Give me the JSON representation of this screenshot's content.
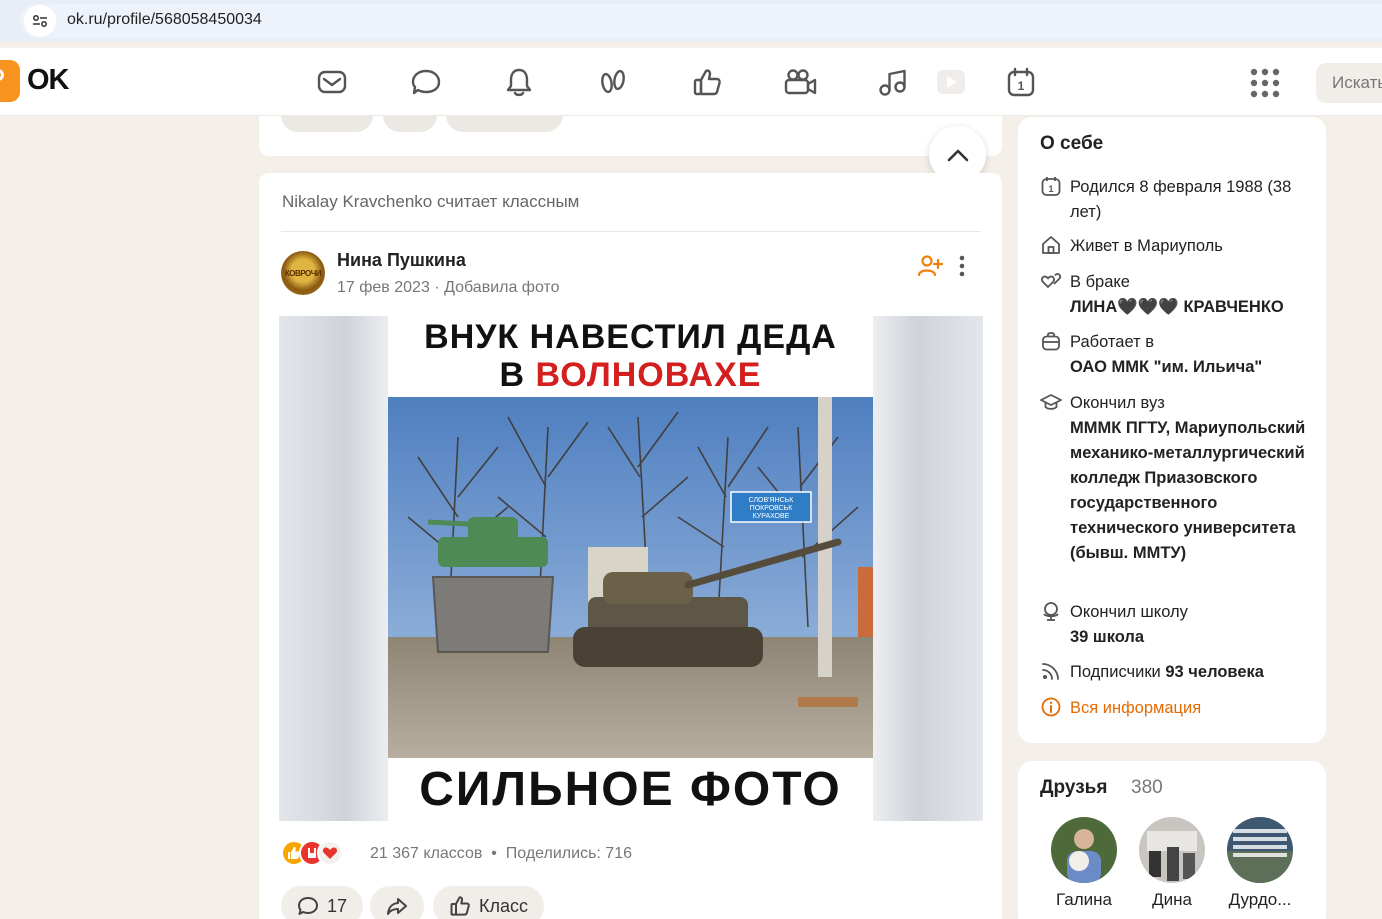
{
  "browser": {
    "url": "ok.ru/profile/568058450034"
  },
  "nav": {
    "logo": "OK",
    "search_placeholder": "Искать"
  },
  "post": {
    "liked_by": "Nikalay Kravchenko считает классным",
    "author": "Нина Пушкина",
    "avatar_text": "КОВРОЧИ",
    "date": "17 фев 2023",
    "action": "Добавила фото",
    "caption_line1": "ВНУК НАВЕСТИЛ ДЕДА",
    "caption_line2_pre": "В ",
    "caption_line2_red": "ВОЛНОВАХЕ",
    "caption_bottom": "СИЛЬНОЕ ФОТО",
    "sign_text": [
      "СЛОВ'ЯНСЬК",
      "ПОКРОВСЬК",
      "КУРАХОВЕ"
    ],
    "likes": "21 367 классов",
    "shares": "Поделились: 716",
    "comments_count": "17",
    "class_label": "Класс"
  },
  "about": {
    "title": "О себе",
    "born": "Родился 8 февраля 1988 (38 лет)",
    "lives_prefix": "Живет в",
    "lives_city": "Мариуполь",
    "marriage_label": "В браке",
    "marriage_partner": "ЛИНА🖤🖤🖤 КРАВЧЕНКО",
    "work_label": "Работает в",
    "work_place": "ОАО ММК \"им. Ильича\"",
    "uni_label": "Окончил вуз",
    "uni_name": "МММК ПГТУ, Мариупольский механико-металлургический колледж Приазовского государственного технического университета (бывш. ММТУ)",
    "school_label": "Окончил школу",
    "school_name": "39 школа",
    "subs_label": "Подписчики",
    "subs_count": "93 человека",
    "all_info": "Вся информация"
  },
  "friends": {
    "title": "Друзья",
    "count": "380",
    "list": [
      {
        "name": "Галина"
      },
      {
        "name": "Дина"
      },
      {
        "name": "Дурдо..."
      }
    ]
  },
  "colors": {
    "accent": "#ee8208",
    "link": "#e56a00",
    "red": "#d41f1f"
  }
}
